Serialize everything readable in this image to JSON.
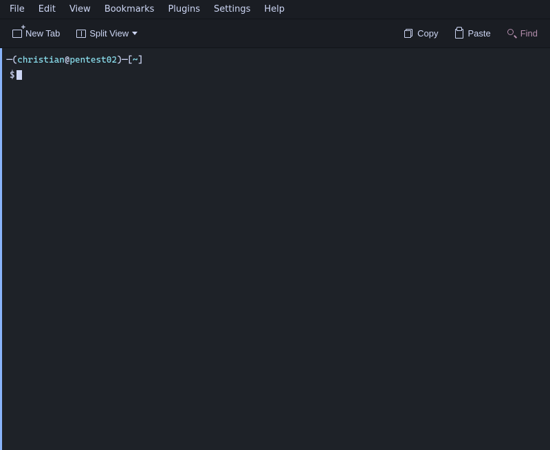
{
  "menubar": {
    "items": [
      {
        "label": "File",
        "id": "file"
      },
      {
        "label": "Edit",
        "id": "edit"
      },
      {
        "label": "View",
        "id": "view"
      },
      {
        "label": "Bookmarks",
        "id": "bookmarks"
      },
      {
        "label": "Plugins",
        "id": "plugins"
      },
      {
        "label": "Settings",
        "id": "settings"
      },
      {
        "label": "Help",
        "id": "help"
      }
    ]
  },
  "toolbar": {
    "new_tab_label": "New Tab",
    "split_view_label": "Split View",
    "copy_label": "Copy",
    "paste_label": "Paste",
    "find_label": "Find"
  },
  "terminal": {
    "prompt_dash": "─",
    "prompt_open": "(",
    "prompt_user": "christian",
    "prompt_at": "@",
    "prompt_host": "pentest02",
    "prompt_close": ")",
    "prompt_dash2": "─",
    "prompt_bracket_open": "[",
    "prompt_dir": "~",
    "prompt_bracket_close": "]",
    "prompt_dollar": "$"
  }
}
